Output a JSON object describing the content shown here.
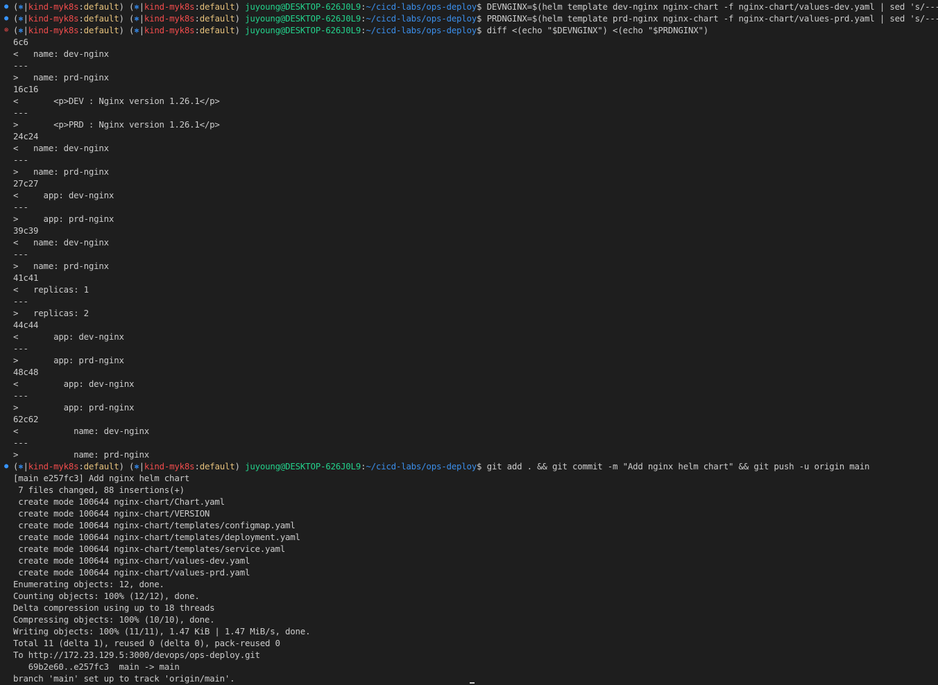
{
  "prompt": {
    "open_paren": "(",
    "k8s_icon": "⎈",
    "separator": "|",
    "context": "kind-myk8s",
    "colon": ":",
    "namespace": "default",
    "close_paren": ")",
    "user_host": "juyoung@DESKTOP-626J0L9",
    "path": "~/cicd-labs/ops-deploy",
    "dollar": "$"
  },
  "colors": {
    "background": "#1e1e1e",
    "text": "#cccccc",
    "context_red": "#f14c4c",
    "namespace_yellow": "#e5c07b",
    "user_green": "#23d18b",
    "path_blue": "#3b8eea",
    "ok_decoration": "#3794ff",
    "error_decoration": "#f14c4c"
  },
  "lines": [
    {
      "type": "prompt",
      "status": "ok",
      "command": "DEVNGINX=$(helm template dev-nginx nginx-chart -f nginx-chart/values-dev.yaml | sed 's/---//g')"
    },
    {
      "type": "prompt",
      "status": "ok",
      "command": "PRDNGINX=$(helm template prd-nginx nginx-chart -f nginx-chart/values-prd.yaml | sed 's/---//g')"
    },
    {
      "type": "prompt",
      "status": "error",
      "command": "diff <(echo \"$DEVNGINX\") <(echo \"$PRDNGINX\")"
    },
    {
      "type": "output",
      "text": "6c6"
    },
    {
      "type": "output",
      "text": "<   name: dev-nginx"
    },
    {
      "type": "output",
      "text": "---"
    },
    {
      "type": "output",
      "text": ">   name: prd-nginx"
    },
    {
      "type": "output",
      "text": "16c16"
    },
    {
      "type": "output",
      "text": "<       <p>DEV : Nginx version 1.26.1</p>"
    },
    {
      "type": "output",
      "text": "---"
    },
    {
      "type": "output",
      "text": ">       <p>PRD : Nginx version 1.26.1</p>"
    },
    {
      "type": "output",
      "text": "24c24"
    },
    {
      "type": "output",
      "text": "<   name: dev-nginx"
    },
    {
      "type": "output",
      "text": "---"
    },
    {
      "type": "output",
      "text": ">   name: prd-nginx"
    },
    {
      "type": "output",
      "text": "27c27"
    },
    {
      "type": "output",
      "text": "<     app: dev-nginx"
    },
    {
      "type": "output",
      "text": "---"
    },
    {
      "type": "output",
      "text": ">     app: prd-nginx"
    },
    {
      "type": "output",
      "text": "39c39"
    },
    {
      "type": "output",
      "text": "<   name: dev-nginx"
    },
    {
      "type": "output",
      "text": "---"
    },
    {
      "type": "output",
      "text": ">   name: prd-nginx"
    },
    {
      "type": "output",
      "text": "41c41"
    },
    {
      "type": "output",
      "text": "<   replicas: 1"
    },
    {
      "type": "output",
      "text": "---"
    },
    {
      "type": "output",
      "text": ">   replicas: 2"
    },
    {
      "type": "output",
      "text": "44c44"
    },
    {
      "type": "output",
      "text": "<       app: dev-nginx"
    },
    {
      "type": "output",
      "text": "---"
    },
    {
      "type": "output",
      "text": ">       app: prd-nginx"
    },
    {
      "type": "output",
      "text": "48c48"
    },
    {
      "type": "output",
      "text": "<         app: dev-nginx"
    },
    {
      "type": "output",
      "text": "---"
    },
    {
      "type": "output",
      "text": ">         app: prd-nginx"
    },
    {
      "type": "output",
      "text": "62c62"
    },
    {
      "type": "output",
      "text": "<           name: dev-nginx"
    },
    {
      "type": "output",
      "text": "---"
    },
    {
      "type": "output",
      "text": ">           name: prd-nginx"
    },
    {
      "type": "prompt",
      "status": "ok",
      "command": "git add . && git commit -m \"Add nginx helm chart\" && git push -u origin main"
    },
    {
      "type": "output",
      "text": "[main e257fc3] Add nginx helm chart"
    },
    {
      "type": "output",
      "text": " 7 files changed, 88 insertions(+)"
    },
    {
      "type": "output",
      "text": " create mode 100644 nginx-chart/Chart.yaml"
    },
    {
      "type": "output",
      "text": " create mode 100644 nginx-chart/VERSION"
    },
    {
      "type": "output",
      "text": " create mode 100644 nginx-chart/templates/configmap.yaml"
    },
    {
      "type": "output",
      "text": " create mode 100644 nginx-chart/templates/deployment.yaml"
    },
    {
      "type": "output",
      "text": " create mode 100644 nginx-chart/templates/service.yaml"
    },
    {
      "type": "output",
      "text": " create mode 100644 nginx-chart/values-dev.yaml"
    },
    {
      "type": "output",
      "text": " create mode 100644 nginx-chart/values-prd.yaml"
    },
    {
      "type": "output",
      "text": "Enumerating objects: 12, done."
    },
    {
      "type": "output",
      "text": "Counting objects: 100% (12/12), done."
    },
    {
      "type": "output",
      "text": "Delta compression using up to 18 threads"
    },
    {
      "type": "output",
      "text": "Compressing objects: 100% (10/10), done."
    },
    {
      "type": "output",
      "text": "Writing objects: 100% (11/11), 1.47 KiB | 1.47 MiB/s, done."
    },
    {
      "type": "output",
      "text": "Total 11 (delta 1), reused 0 (delta 0), pack-reused 0"
    },
    {
      "type": "output",
      "text": "To http://172.23.129.5:3000/devops/ops-deploy.git"
    },
    {
      "type": "output",
      "text": "   69b2e60..e257fc3  main -> main"
    },
    {
      "type": "output",
      "text": "branch 'main' set up to track 'origin/main'."
    }
  ]
}
